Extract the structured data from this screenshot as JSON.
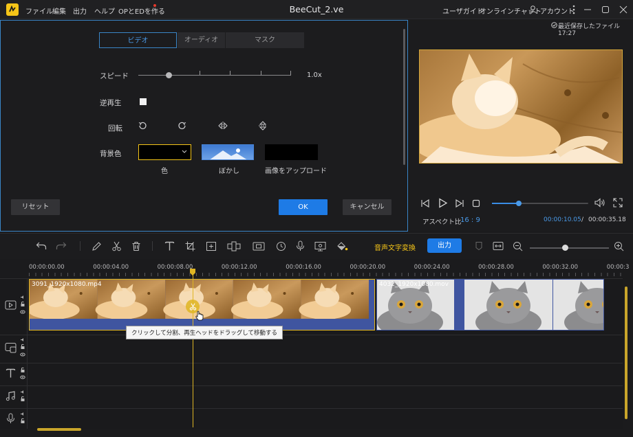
{
  "app": {
    "title": "BeeCut_2.ve",
    "menus": [
      "ファイル",
      "編集",
      "出力",
      "ヘルプ",
      "OPとEDを作る"
    ],
    "right_links": [
      "ユーザガイド",
      "オンラインチャット",
      "アカウント"
    ]
  },
  "settings": {
    "tabs": [
      "ビデオ",
      "オーディオ",
      "マスク"
    ],
    "speed_label": "スピード",
    "speed_value": "1.0x",
    "speed_fraction": 0.2,
    "reverse_label": "逆再生",
    "rotate_label": "回転",
    "bg_label": "背景色",
    "bg_options": [
      "色",
      "ぼかし",
      "画像をアップロード"
    ],
    "reset": "リセット",
    "ok": "OK",
    "cancel": "キャンセル"
  },
  "preview": {
    "saved_notice": "最近保存したファイル 17:27",
    "aspect_label": "アスペクト比",
    "aspect_value": "16 : 9",
    "time_current": "00:00:10.05",
    "time_separator": "/",
    "time_total": "00:00:35.18",
    "progress_fraction": 0.28
  },
  "toolbar": {
    "speech_to_text": "音声文字変換",
    "export": "出力"
  },
  "timeline": {
    "ruler": [
      "00:00:00.00",
      "00:00:04.00",
      "00:00:08.00",
      "00:00:12.00",
      "00:00:16.00",
      "00:00:20.00",
      "00:00:24.00",
      "00:00:28.00",
      "00:00:32.00",
      "00:00:3"
    ],
    "clip1_name": "3091_1920x1080.mp4",
    "clip2_name": "4032_1920x1080.mov",
    "tooltip": "クリックして分割、再生ヘッドをドラッグして移動する"
  },
  "colors": {
    "accent": "#1e7be6",
    "highlight": "#f5c518",
    "playhead": "#e0b623"
  }
}
